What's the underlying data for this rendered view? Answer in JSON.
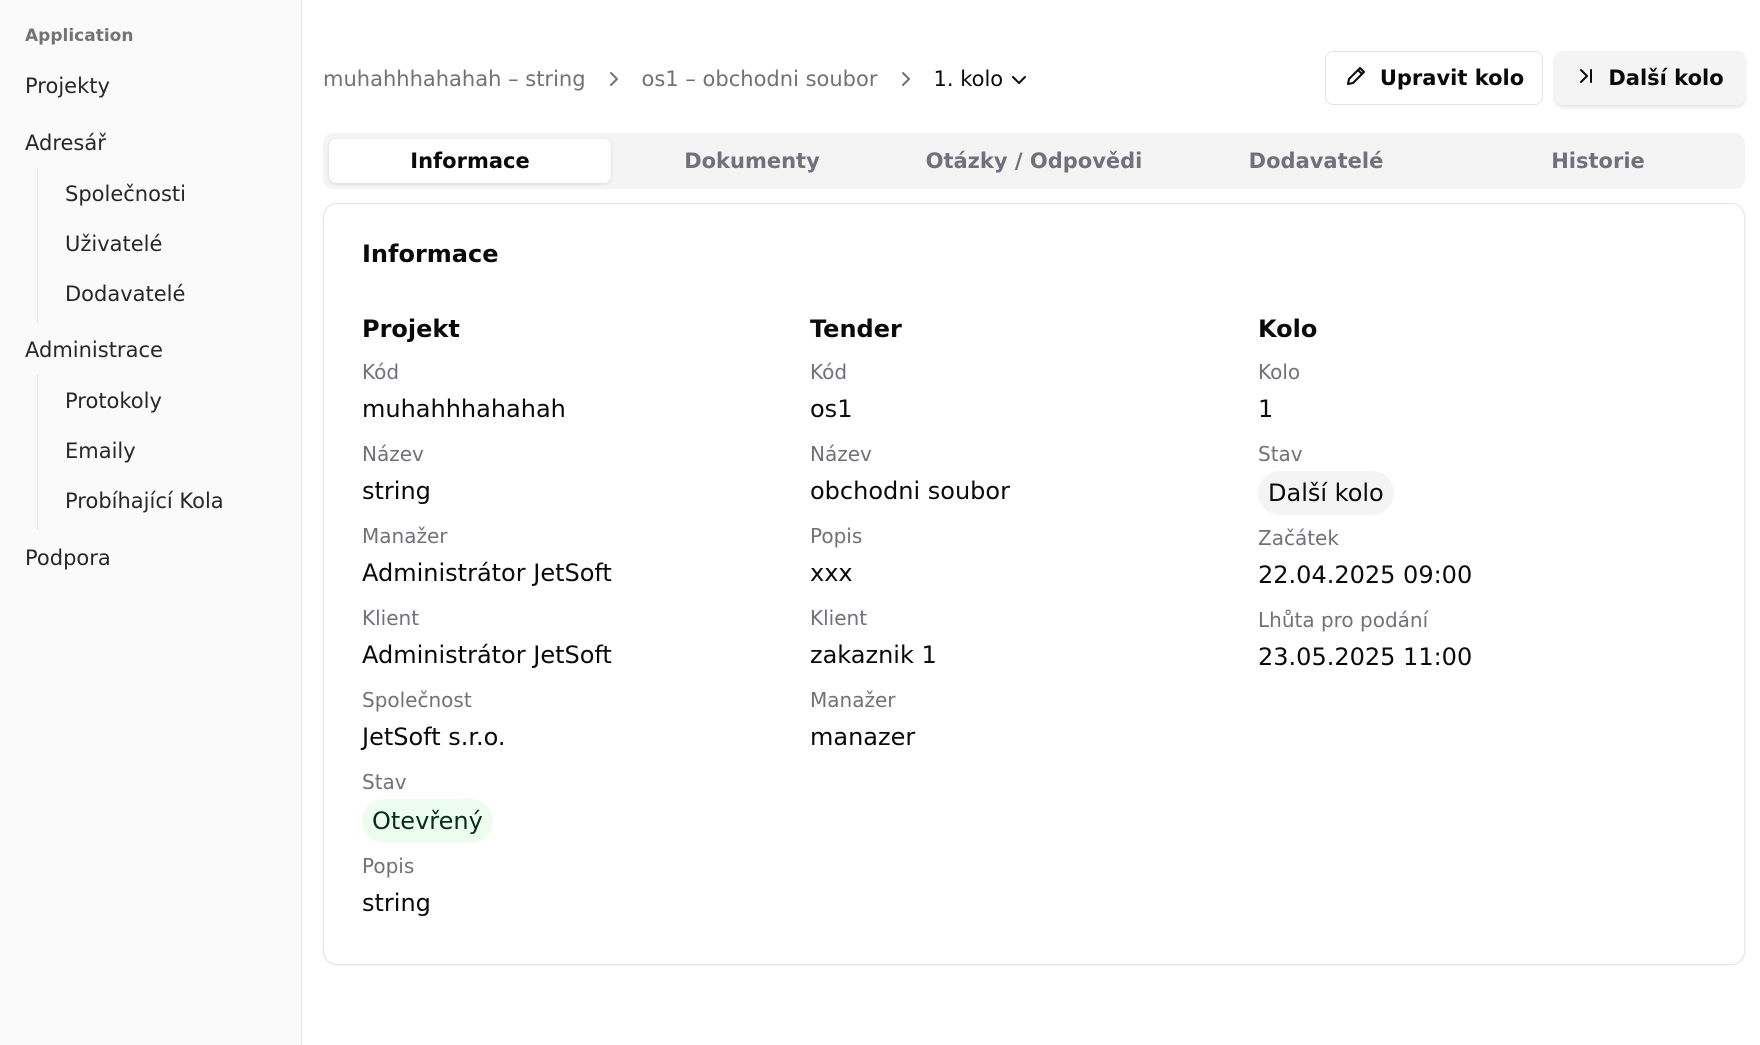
{
  "sidebar": {
    "group_label": "Application",
    "projekty": "Projekty",
    "adresar": "Adresář",
    "adresar_items": [
      "Společnosti",
      "Uživatelé",
      "Dodavatelé"
    ],
    "administrace": "Administrace",
    "administrace_items": [
      "Protokoly",
      "Emaily",
      "Probíhající Kola"
    ],
    "podpora": "Podpora"
  },
  "breadcrumb": {
    "items": [
      "muhahhhahahah – string",
      "os1 – obchodni soubor"
    ],
    "current": "1. kolo"
  },
  "actions": {
    "edit_label": "Upravit kolo",
    "next_label": "Další kolo"
  },
  "tabs": [
    "Informace",
    "Dokumenty",
    "Otázky / Odpovědi",
    "Dodavatelé",
    "Historie"
  ],
  "active_tab": "Informace",
  "card": {
    "title": "Informace",
    "projekt": {
      "title": "Projekt",
      "kod_label": "Kód",
      "kod": "muhahhhahahah",
      "nazev_label": "Název",
      "nazev": "string",
      "manazer_label": "Manažer",
      "manazer": "Administrátor JetSoft",
      "klient_label": "Klient",
      "klient": "Administrátor JetSoft",
      "spolecnost_label": "Společnost",
      "spolecnost": "JetSoft s.r.o.",
      "stav_label": "Stav",
      "stav": "Otevřený",
      "popis_label": "Popis",
      "popis": "string"
    },
    "tender": {
      "title": "Tender",
      "kod_label": "Kód",
      "kod": "os1",
      "nazev_label": "Název",
      "nazev": "obchodni soubor",
      "popis_label": "Popis",
      "popis": "xxx",
      "klient_label": "Klient",
      "klient": "zakaznik 1",
      "manazer_label": "Manažer",
      "manazer": "manazer"
    },
    "kolo": {
      "title": "Kolo",
      "kolo_label": "Kolo",
      "kolo": "1",
      "stav_label": "Stav",
      "stav": "Další kolo",
      "zacatek_label": "Začátek",
      "zacatek": "22.04.2025 09:00",
      "lhuta_label": "Lhůta pro podání",
      "lhuta": "23.05.2025 11:00"
    }
  },
  "colors": {
    "status_open_bg": "#ecfdf0",
    "muted_text": "#71717a",
    "sidebar_bg": "#fafafa"
  }
}
